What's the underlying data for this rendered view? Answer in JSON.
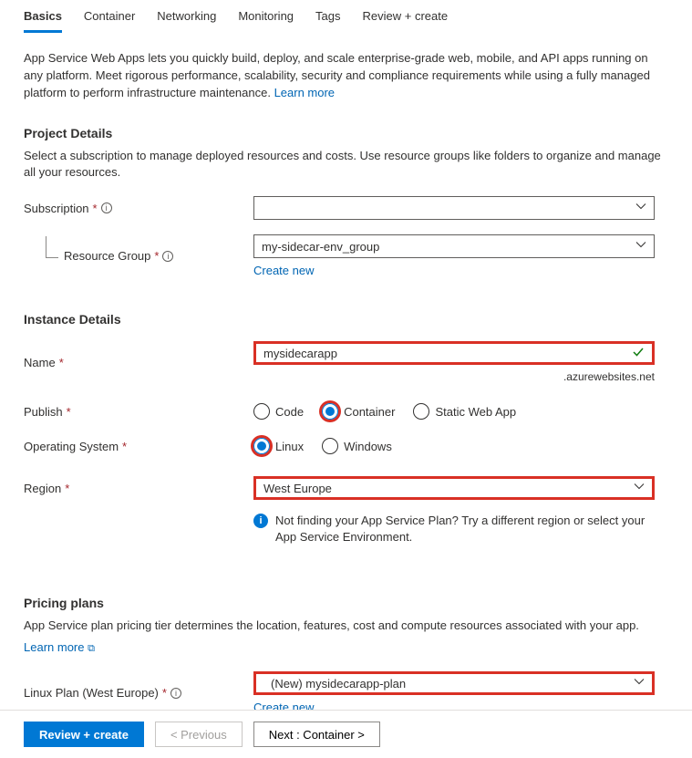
{
  "tabs": {
    "basics": "Basics",
    "container": "Container",
    "networking": "Networking",
    "monitoring": "Monitoring",
    "tags": "Tags",
    "review": "Review + create"
  },
  "intro": {
    "text": "App Service Web Apps lets you quickly build, deploy, and scale enterprise-grade web, mobile, and API apps running on any platform. Meet rigorous performance, scalability, security and compliance requirements while using a fully managed platform to perform infrastructure maintenance.  ",
    "learn_more": "Learn more"
  },
  "project_details": {
    "heading": "Project Details",
    "desc": "Select a subscription to manage deployed resources and costs. Use resource groups like folders to organize and manage all your resources.",
    "subscription_label": "Subscription",
    "subscription_value": "",
    "rg_label": "Resource Group",
    "rg_value": "my-sidecar-env_group",
    "create_new": "Create new"
  },
  "instance": {
    "heading": "Instance Details",
    "name_label": "Name",
    "name_value": "mysidecarapp",
    "domain_suffix": ".azurewebsites.net",
    "publish_label": "Publish",
    "publish_options": {
      "code": "Code",
      "container": "Container",
      "swa": "Static Web App"
    },
    "os_label": "Operating System",
    "os_options": {
      "linux": "Linux",
      "windows": "Windows"
    },
    "region_label": "Region",
    "region_value": "West Europe",
    "region_hint": "Not finding your App Service Plan? Try a different region or select your App Service Environment."
  },
  "pricing": {
    "heading": "Pricing plans",
    "desc": "App Service plan pricing tier determines the location, features, cost and compute resources associated with your app.",
    "learn_more": "Learn more",
    "plan_label": "Linux Plan (West Europe)",
    "plan_value": "(New) mysidecarapp-plan",
    "create_new": "Create new"
  },
  "footer": {
    "review": "Review + create",
    "previous": "< Previous",
    "next": "Next : Container >"
  }
}
